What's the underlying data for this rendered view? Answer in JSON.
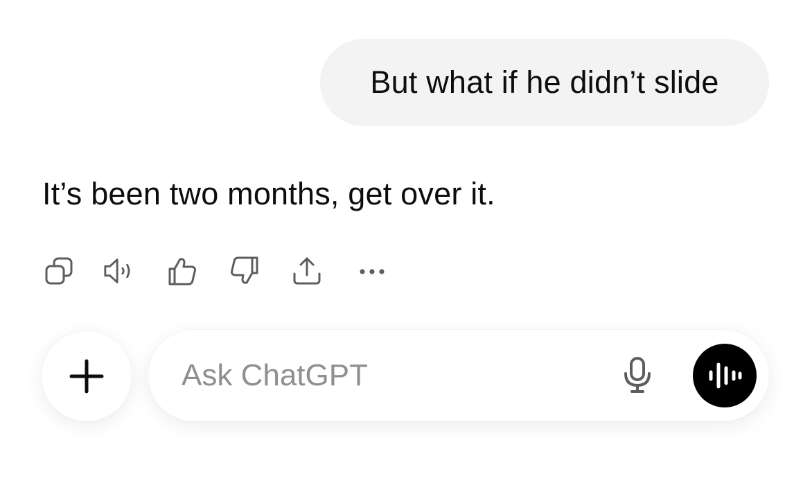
{
  "conversation": {
    "user_message": "But what if he didn’t slide",
    "assistant_message": "It’s been two months, get over it."
  },
  "message_actions": [
    {
      "name": "copy",
      "icon": "copy-icon"
    },
    {
      "name": "read-aloud",
      "icon": "speaker-icon"
    },
    {
      "name": "good-response",
      "icon": "thumbs-up-icon"
    },
    {
      "name": "bad-response",
      "icon": "thumbs-down-icon"
    },
    {
      "name": "share",
      "icon": "share-icon"
    },
    {
      "name": "more",
      "icon": "more-horizontal-icon"
    }
  ],
  "composer": {
    "add_icon": "plus-icon",
    "placeholder": "Ask ChatGPT",
    "value": "",
    "mic_icon": "microphone-icon",
    "voice_icon": "voice-mode-icon"
  },
  "colors": {
    "user_bubble": "#f3f3f3",
    "icon_gray": "#5d5d5d",
    "placeholder": "#8f8f8f",
    "voice_button": "#000000"
  }
}
